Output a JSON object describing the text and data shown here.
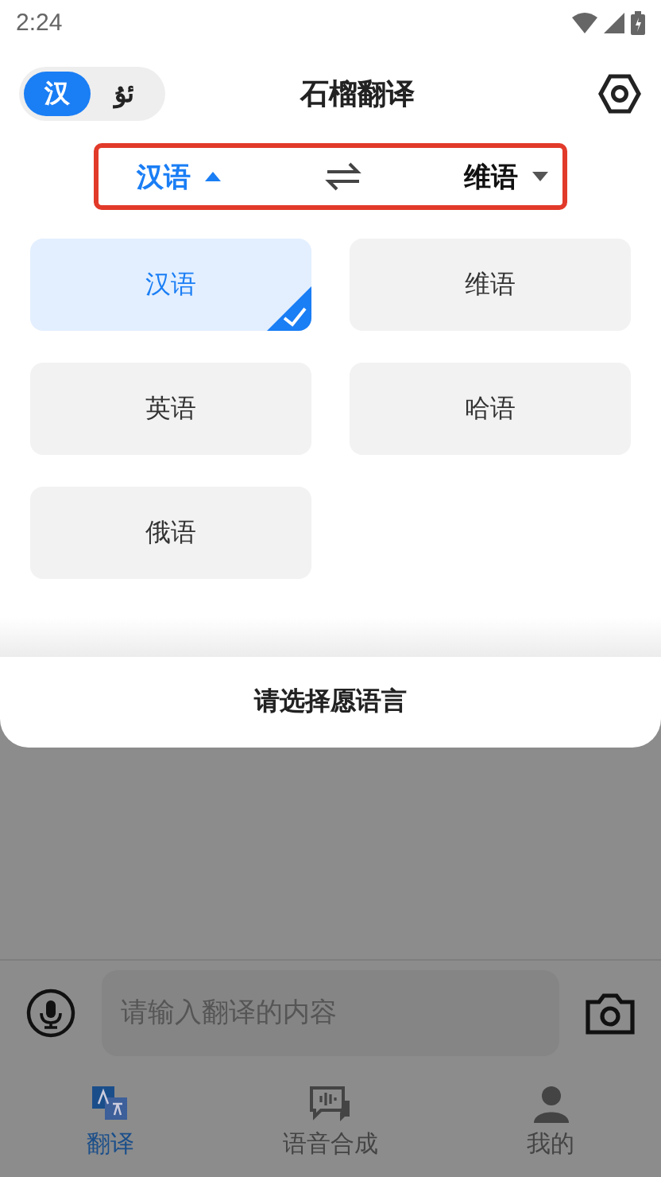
{
  "status_bar": {
    "time": "2:24"
  },
  "header": {
    "script_toggle": [
      {
        "label": "汉",
        "selected": true
      },
      {
        "label": "ئۇ",
        "selected": false
      }
    ],
    "title": "石榴翻译"
  },
  "language_bar": {
    "source": {
      "label": "汉语",
      "expanded": true
    },
    "target": {
      "label": "维语",
      "expanded": false
    }
  },
  "languages": [
    {
      "label": "汉语",
      "selected": true
    },
    {
      "label": "维语",
      "selected": false
    },
    {
      "label": "英语",
      "selected": false
    },
    {
      "label": "哈语",
      "selected": false
    },
    {
      "label": "俄语",
      "selected": false
    }
  ],
  "sheet_title": "请选择愿语言",
  "input": {
    "placeholder": "请输入翻译的内容"
  },
  "tabs": [
    {
      "label": "翻译",
      "selected": true
    },
    {
      "label": "语音合成",
      "selected": false
    },
    {
      "label": "我的",
      "selected": false
    }
  ]
}
